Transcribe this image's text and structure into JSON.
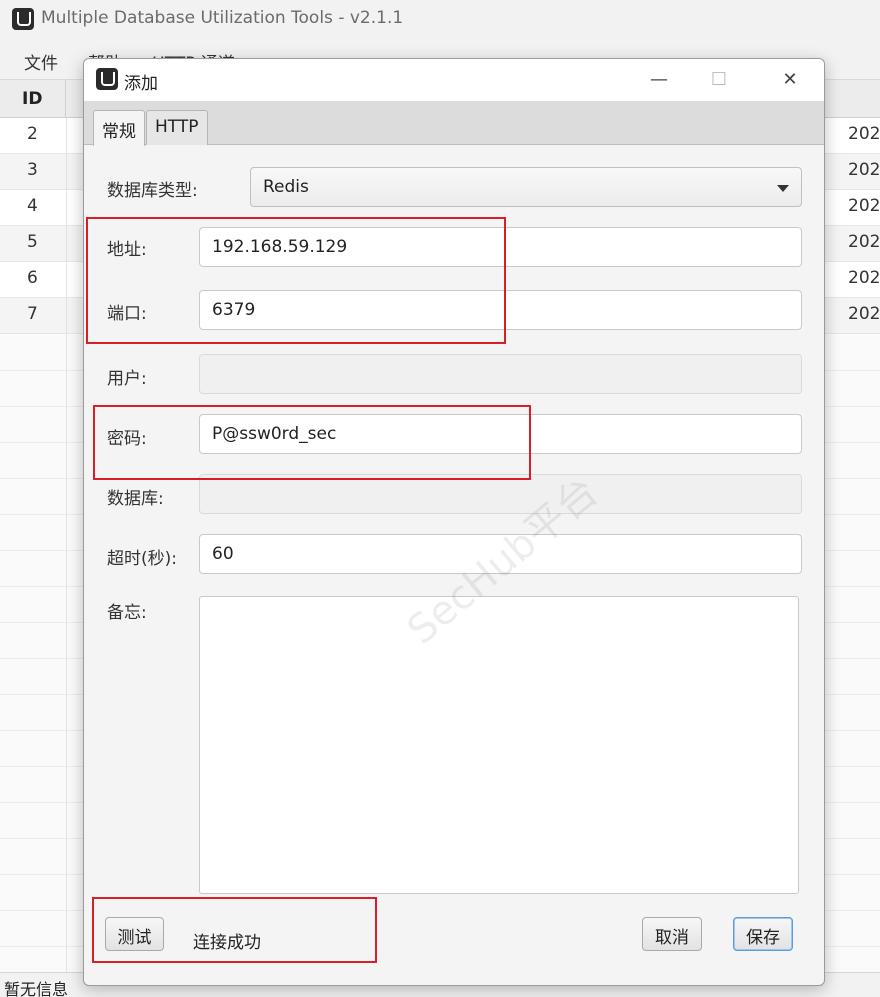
{
  "app": {
    "title": "Multiple Database Utilization Tools - v2.1.1"
  },
  "menu": {
    "items": [
      "文件",
      "帮助",
      "HTTP 通道"
    ]
  },
  "table": {
    "id_header": "ID",
    "rows": [
      {
        "id": "2",
        "date": "202"
      },
      {
        "id": "3",
        "date": "202"
      },
      {
        "id": "4",
        "date": "202"
      },
      {
        "id": "5",
        "date": "202"
      },
      {
        "id": "6",
        "date": "202"
      },
      {
        "id": "7",
        "date": "202"
      }
    ]
  },
  "status_bar": {
    "text": "暂无信息"
  },
  "dialog": {
    "title": "添加",
    "window_buttons": {
      "minimize": "—",
      "maximize": "☐",
      "close": "✕"
    },
    "tabs": [
      {
        "label": "常规",
        "active": true
      },
      {
        "label": "HTTP",
        "active": false
      }
    ],
    "form": {
      "db_type_label": "数据库类型:",
      "db_type_value": "Redis",
      "address_label": "地址:",
      "address_value": "192.168.59.129",
      "port_label": "端口:",
      "port_value": "6379",
      "user_label": "用户:",
      "user_value": "",
      "password_label": "密码:",
      "password_value": "P@ssw0rd_sec",
      "database_label": "数据库:",
      "database_value": "",
      "timeout_label": "超时(秒):",
      "timeout_value": "60",
      "notes_label": "备忘:",
      "notes_value": ""
    },
    "buttons": {
      "test": "测试",
      "cancel": "取消",
      "save": "保存"
    },
    "test_result": "连接成功"
  },
  "watermark": "SecHub平台",
  "colors": {
    "highlight": "#d81e2a",
    "primary_border": "#5a9bd8"
  }
}
